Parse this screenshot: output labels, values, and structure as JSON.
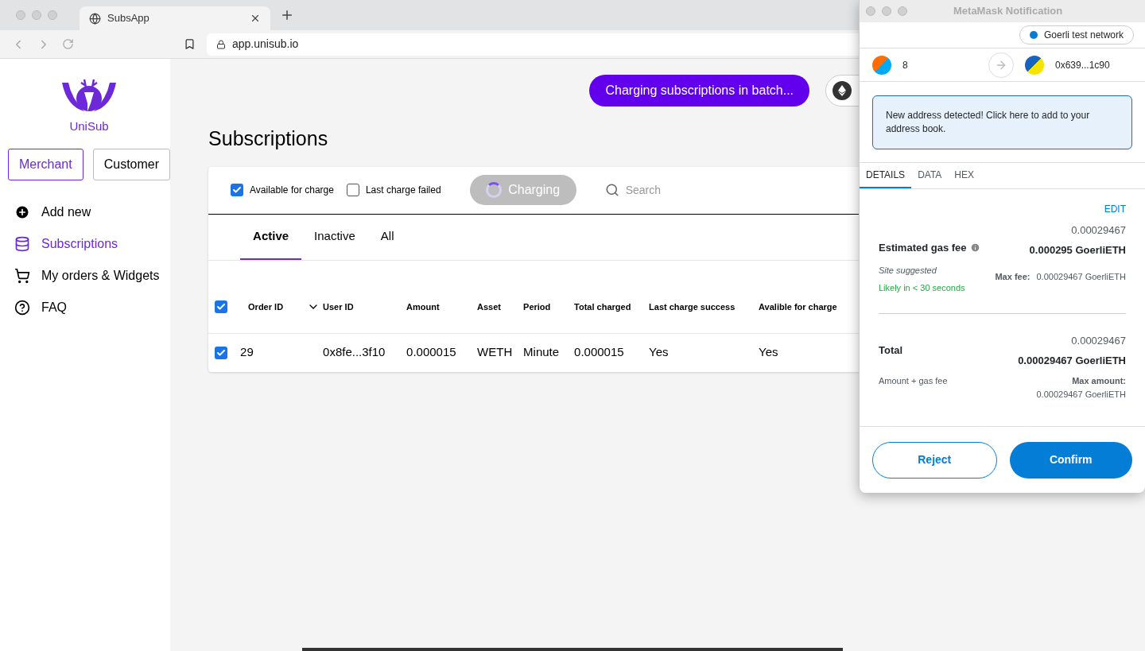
{
  "browser": {
    "tab_title": "SubsApp",
    "url": "app.unisub.io"
  },
  "sidebar": {
    "logo_text": "UniSub",
    "roles": [
      {
        "label": "Merchant",
        "selected": true
      },
      {
        "label": "Customer",
        "selected": false
      }
    ],
    "nav": [
      {
        "label": "Add new",
        "kind": "plus",
        "selected": false
      },
      {
        "label": "Subscriptions",
        "kind": "database",
        "selected": true
      },
      {
        "label": "My orders & Widgets",
        "kind": "cart",
        "selected": false
      },
      {
        "label": "FAQ",
        "kind": "help",
        "selected": false
      }
    ]
  },
  "main": {
    "batch_button": "Charging subscriptions in batch...",
    "title": "Subscriptions",
    "filters": [
      {
        "label": "Available for charge",
        "checked": true
      },
      {
        "label": "Last charge failed",
        "checked": false
      }
    ],
    "charging_button": "Charging",
    "search": {
      "placeholder": "Search"
    },
    "tabs": [
      {
        "label": "Active",
        "selected": true
      },
      {
        "label": "Inactive",
        "selected": false
      },
      {
        "label": "All",
        "selected": false
      }
    ],
    "table": {
      "select_all_checked": true,
      "columns": [
        "Order ID",
        "User ID",
        "Amount",
        "Asset",
        "Period",
        "Total charged",
        "Last charge success",
        "Avalible for charge"
      ],
      "rows": [
        {
          "checked": true,
          "cells": [
            "29",
            "0x8fe...3f10",
            "0.000015",
            "WETH",
            "Minute",
            "0.000015",
            "Yes",
            "Yes"
          ]
        }
      ]
    }
  },
  "popup": {
    "title": "MetaMask Notification",
    "network": "Goerli test network",
    "from": "8",
    "to": "0x639...1c90",
    "notice": "New address detected! Click here to add to your address book.",
    "tabs": [
      {
        "label": "DETAILS",
        "selected": true
      },
      {
        "label": "DATA",
        "selected": false
      },
      {
        "label": "HEX",
        "selected": false
      }
    ],
    "edit": "EDIT",
    "gas_label": "Estimated gas fee",
    "gas_value": "0.00029467",
    "gas_value_bold": "0.000295 GoerliETH",
    "site_suggested": "Site suggested",
    "likely": "Likely in < 30 seconds",
    "max_fee_label": "Max fee:",
    "max_fee_value": "0.00029467 GoerliETH",
    "total_label": "Total",
    "total_value": "0.00029467",
    "total_bold": "0.00029467 GoerliETH",
    "amount_gas": "Amount + gas fee",
    "max_amount_label": "Max amount:",
    "max_amount_value": "0.00029467 GoerliETH",
    "reject": "Reject",
    "confirm": "Confirm"
  }
}
